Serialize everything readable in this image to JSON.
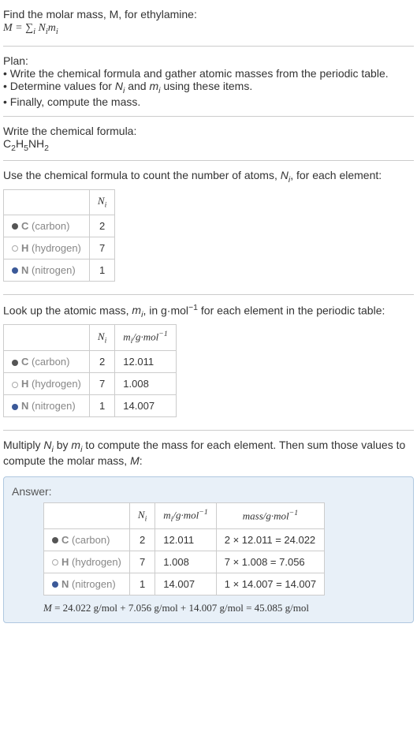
{
  "intro": {
    "line1": "Find the molar mass, M, for ethylamine:",
    "formula_html": "M = &sum;<sub style='font-style:italic'>i</sub> N<sub>i</sub>m<sub>i</sub>"
  },
  "plan": {
    "title": "Plan:",
    "item1": "• Write the chemical formula and gather atomic masses from the periodic table.",
    "item2_html": "• Determine values for <i>N<sub>i</sub></i> and <i>m<sub>i</sub></i> using these items.",
    "item3": "• Finally, compute the mass."
  },
  "chem_formula": {
    "title": "Write the chemical formula:",
    "formula_html": "C<sub>2</sub>H<sub>5</sub>NH<sub>2</sub>"
  },
  "count_atoms": {
    "title_html": "Use the chemical formula to count the number of atoms, <i>N<sub>i</sub></i>, for each element:",
    "header_ni_html": "N<sub>i</sub>",
    "rows": [
      {
        "sym": "C",
        "name": "(carbon)",
        "bullet": "bullet-c",
        "ni": "2"
      },
      {
        "sym": "H",
        "name": "(hydrogen)",
        "bullet": "bullet-h",
        "ni": "7"
      },
      {
        "sym": "N",
        "name": "(nitrogen)",
        "bullet": "bullet-n",
        "ni": "1"
      }
    ]
  },
  "atomic_mass": {
    "title_html": "Look up the atomic mass, <i>m<sub>i</sub></i>, in g·mol<sup>−1</sup> for each element in the periodic table:",
    "header_ni_html": "N<sub>i</sub>",
    "header_mi_html": "m<sub>i</sub>/g·mol<sup>−1</sup>",
    "rows": [
      {
        "sym": "C",
        "name": "(carbon)",
        "bullet": "bullet-c",
        "ni": "2",
        "mi": "12.011"
      },
      {
        "sym": "H",
        "name": "(hydrogen)",
        "bullet": "bullet-h",
        "ni": "7",
        "mi": "1.008"
      },
      {
        "sym": "N",
        "name": "(nitrogen)",
        "bullet": "bullet-n",
        "ni": "1",
        "mi": "14.007"
      }
    ]
  },
  "multiply": {
    "text_html": "Multiply <i>N<sub>i</sub></i> by <i>m<sub>i</sub></i> to compute the mass for each element. Then sum those values to compute the molar mass, <i>M</i>:"
  },
  "answer": {
    "label": "Answer:",
    "header_ni_html": "N<sub>i</sub>",
    "header_mi_html": "m<sub>i</sub>/g·mol<sup>−1</sup>",
    "header_mass_html": "mass/g·mol<sup>−1</sup>",
    "rows": [
      {
        "sym": "C",
        "name": "(carbon)",
        "bullet": "bullet-c",
        "ni": "2",
        "mi": "12.011",
        "mass": "2 × 12.011 = 24.022"
      },
      {
        "sym": "H",
        "name": "(hydrogen)",
        "bullet": "bullet-h",
        "ni": "7",
        "mi": "1.008",
        "mass": "7 × 1.008 = 7.056"
      },
      {
        "sym": "N",
        "name": "(nitrogen)",
        "bullet": "bullet-n",
        "ni": "1",
        "mi": "14.007",
        "mass": "1 × 14.007 = 14.007"
      }
    ],
    "result_html": "<i>M</i> = 24.022 g/mol + 7.056 g/mol + 14.007 g/mol = 45.085 g/mol"
  }
}
